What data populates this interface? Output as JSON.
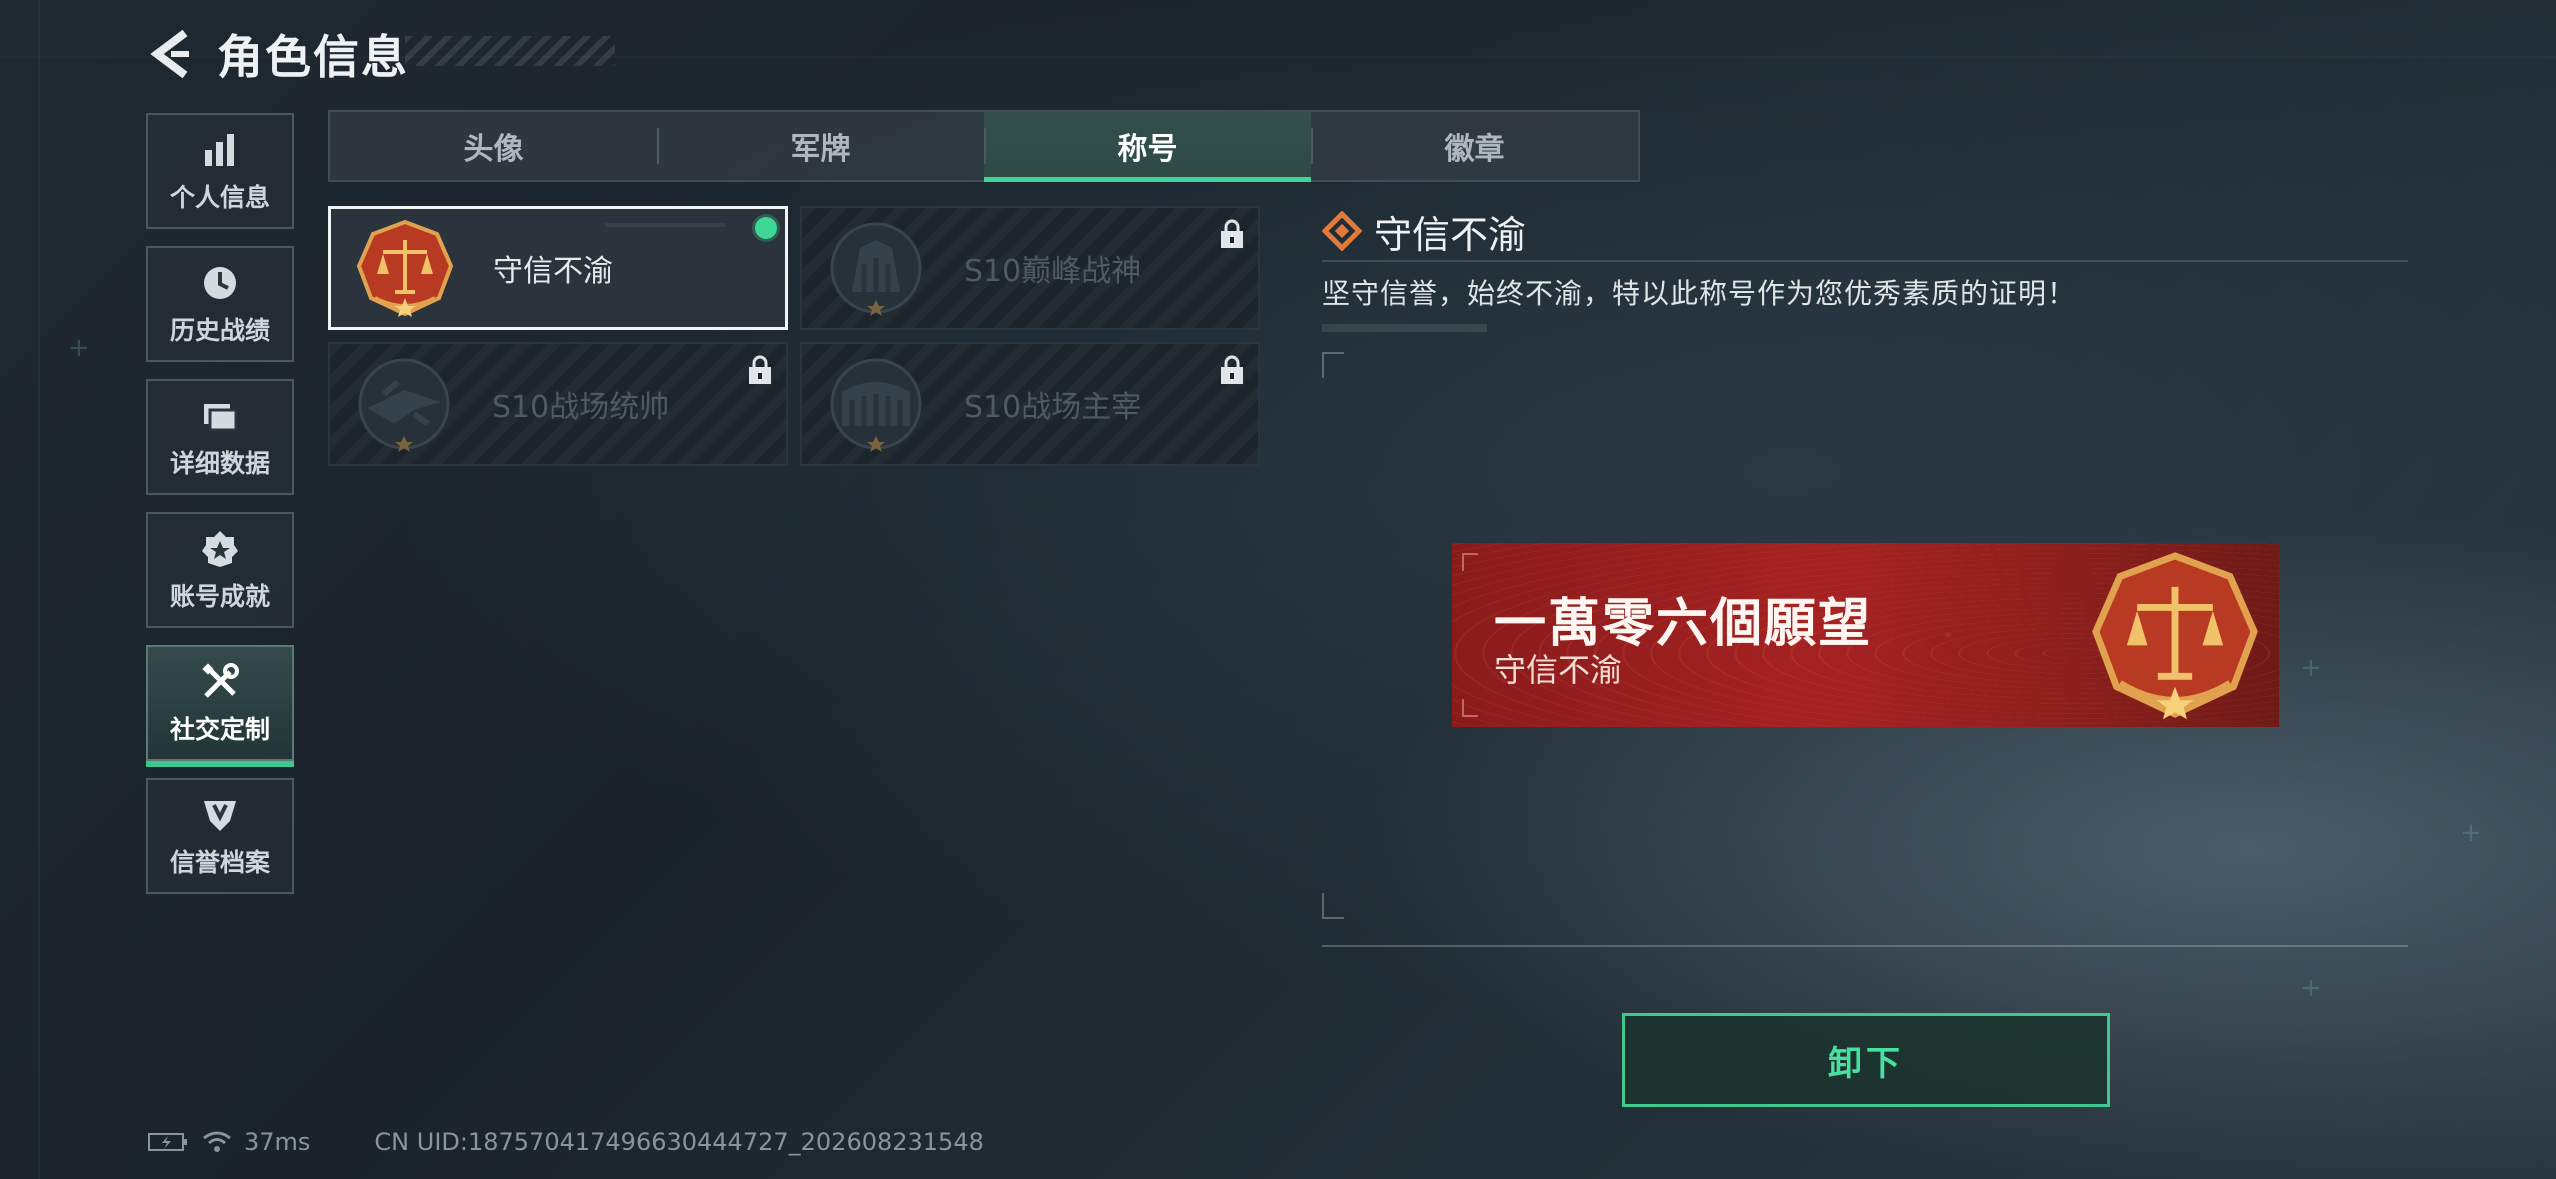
{
  "header": {
    "title": "角色信息",
    "back_icon": "chevron-left-icon"
  },
  "sidenav": {
    "items": [
      {
        "label": "个人信息",
        "icon": "bar-chart-icon",
        "active": false
      },
      {
        "label": "历史战绩",
        "icon": "clock-icon",
        "active": false
      },
      {
        "label": "详细数据",
        "icon": "folder-icon",
        "active": false
      },
      {
        "label": "账号成就",
        "icon": "medal-icon",
        "active": false
      },
      {
        "label": "社交定制",
        "icon": "wrench-icon",
        "active": true
      },
      {
        "label": "信誉档案",
        "icon": "shield-badge-icon",
        "active": false
      }
    ]
  },
  "tabs": [
    {
      "label": "头像",
      "active": false
    },
    {
      "label": "军牌",
      "active": false
    },
    {
      "label": "称号",
      "active": true
    },
    {
      "label": "徽章",
      "active": false
    }
  ],
  "cards": [
    {
      "label": "守信不渝",
      "emblem": "scales-emblem-icon",
      "selected": true,
      "locked": false,
      "equipped": true
    },
    {
      "label": "S10巅峰战神",
      "emblem": "fortress-emblem-icon",
      "selected": false,
      "locked": true,
      "equipped": false
    },
    {
      "label": "S10战场统帅",
      "emblem": "aircraft-emblem-icon",
      "selected": false,
      "locked": true,
      "equipped": false
    },
    {
      "label": "S10战场主宰",
      "emblem": "colosseum-emblem-icon",
      "selected": false,
      "locked": true,
      "equipped": false
    }
  ],
  "detail": {
    "title": "守信不渝",
    "description": "坚守信誉，始终不渝，特以此称号作为您优秀素质的证明！",
    "title_icon": "diamond-icon"
  },
  "banner": {
    "player_name": "一萬零六個願望",
    "title": "守信不渝",
    "emblem": "scales-emblem-icon"
  },
  "actions": {
    "unequip_label": "卸下"
  },
  "status_bar": {
    "ping": "37ms",
    "uid": "CN UID:18757041749663044472​7_202608231548"
  },
  "colors": {
    "accent": "#40d39b",
    "banner_red": "#a62222",
    "emblem_gold": "#d9a24a"
  }
}
